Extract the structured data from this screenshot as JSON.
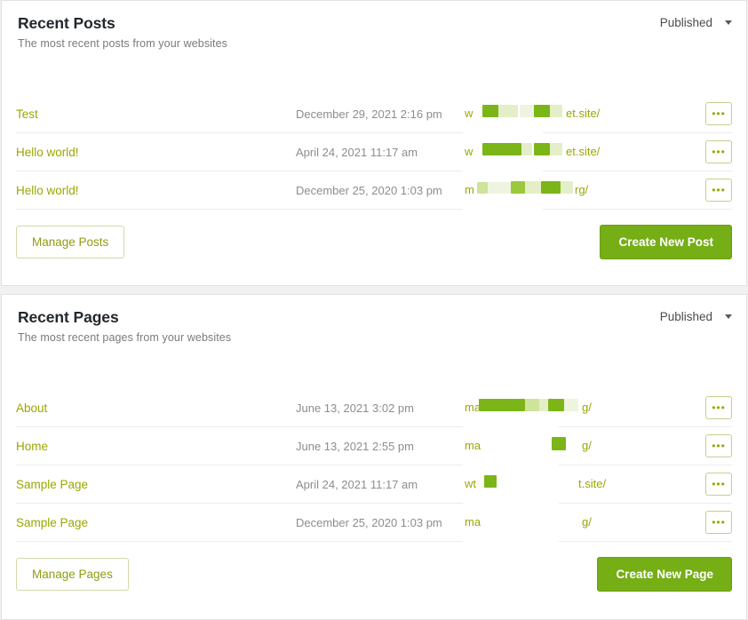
{
  "posts_card": {
    "title": "Recent Posts",
    "subtitle": "The most recent posts from your websites",
    "filter": {
      "label": "Published",
      "icon": "chevron-down-icon"
    },
    "rows": [
      {
        "title": "Test",
        "date": "December 29, 2021 2:16 pm",
        "url_prefix": "w",
        "url_suffix": "et.site/",
        "actions_label": "•••"
      },
      {
        "title": "Hello world!",
        "date": "April 24, 2021 11:17 am",
        "url_prefix": "w",
        "url_suffix": "et.site/",
        "actions_label": "•••"
      },
      {
        "title": "Hello world!",
        "date": "December 25, 2020 1:03 pm",
        "url_prefix": "m",
        "url_suffix": "rg/",
        "actions_label": "•••"
      }
    ],
    "manage_label": "Manage Posts",
    "create_label": "Create New Post"
  },
  "pages_card": {
    "title": "Recent Pages",
    "subtitle": "The most recent pages from your websites",
    "filter": {
      "label": "Published",
      "icon": "chevron-down-icon"
    },
    "rows": [
      {
        "title": "About",
        "date": "June 13, 2021 3:02 pm",
        "url_prefix": "ma",
        "url_suffix": "g/",
        "actions_label": "•••"
      },
      {
        "title": "Home",
        "date": "June 13, 2021 2:55 pm",
        "url_prefix": "ma",
        "url_suffix": "g/",
        "actions_label": "•••"
      },
      {
        "title": "Sample Page",
        "date": "April 24, 2021 11:17 am",
        "url_prefix": "wt",
        "url_suffix": "t.site/",
        "actions_label": "•••"
      },
      {
        "title": "Sample Page",
        "date": "December 25, 2020 1:03 pm",
        "url_prefix": "ma",
        "url_suffix": "g/",
        "actions_label": "•••"
      }
    ],
    "manage_label": "Manage Pages",
    "create_label": "Create New Page"
  },
  "colors": {
    "accent_green": "#76ae16",
    "link_green": "#9aa700",
    "redact_strong": "#7cb518",
    "redact_soft": "#cfe39a",
    "card_bg": "#ffffff",
    "border": "#e2e2e2"
  }
}
